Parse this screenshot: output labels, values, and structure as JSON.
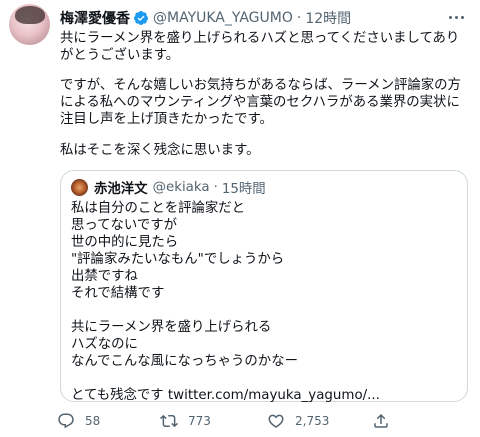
{
  "tweet": {
    "author_name": "梅澤愛優香",
    "handle": "@MAYUKA_YAGUMO",
    "separator": "·",
    "time": "12時間",
    "paragraphs": [
      "共にラーメン界を盛り上げられるハズと思ってくださいましてありがとうございます。",
      "ですが、そんな嬉しいお気持ちがあるならば、ラーメン評論家の方による私へのマウンティングや言葉のセクハラがある業界の実状に注目し声を上げ頂きたかったです。",
      "私はそこを深く残念に思います。"
    ]
  },
  "quote": {
    "author_name": "赤池洋文",
    "handle": "@ekiaka",
    "separator": "·",
    "time": "15時間",
    "text": "私は自分のことを評論家だと\n思ってないですが\n世の中的に見たら\n\"評論家みたいなもん\"でしょうから\n出禁ですね\nそれで結構です\n\n共にラーメン界を盛り上げられる\nハズなのに\nなんでこんな風になっちゃうのかなー\n\nとても残念です twitter.com/mayuka_yagumo/..."
  },
  "actions": {
    "reply_count": "58",
    "retweet_count": "773",
    "like_count": "2,753"
  },
  "icons": {
    "verified": "verified-badge-icon",
    "more": "more-icon",
    "reply": "reply-icon",
    "retweet": "retweet-icon",
    "like": "heart-icon",
    "share": "share-icon"
  },
  "colors": {
    "accent": "#1d9bf0",
    "text": "#0f1419",
    "muted": "#536471",
    "border": "#cfd9de"
  }
}
